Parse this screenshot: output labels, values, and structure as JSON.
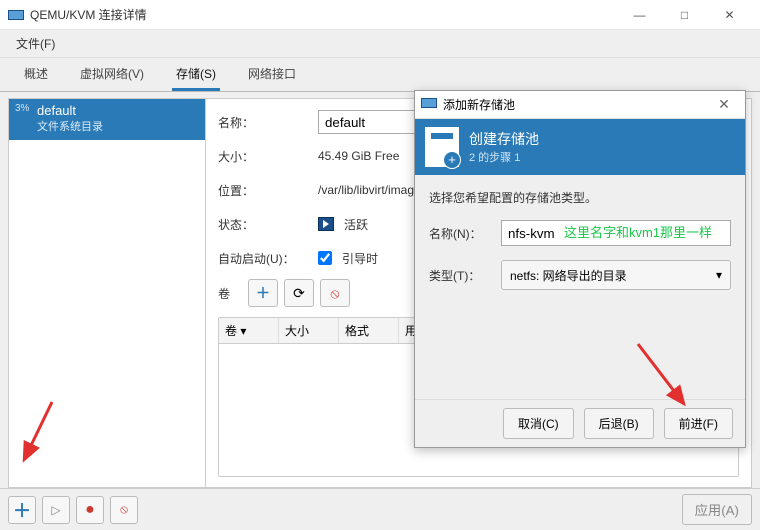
{
  "window": {
    "title": "QEMU/KVM 连接详情",
    "menu": {
      "file": "文件(F)"
    },
    "close_glyph": "✕",
    "max_glyph": "□",
    "min_glyph": "—"
  },
  "tabs": {
    "overview": "概述",
    "vnet": "虚拟网络(V)",
    "storage": "存储(S)",
    "netiface": "网络接口"
  },
  "sidebar": {
    "usage_pct": "3%",
    "pool_name": "default",
    "pool_sub": "文件系统目录"
  },
  "detail": {
    "name_label": "名称：",
    "name_value": "default",
    "size_label": "大小：",
    "size_value": "45.49 GiB Free",
    "location_label": "位置：",
    "location_value": "/var/lib/libvirt/images",
    "status_label": "状态：",
    "status_value": "活跃",
    "autostart_label": "自动启动(U)：",
    "autostart_value": "引导时",
    "volumes_label": "卷",
    "cols": {
      "name": "卷 ▾",
      "size": "大小",
      "format": "格式",
      "usedby": "用途"
    }
  },
  "bottombar": {
    "apply": "应用(A)"
  },
  "dialog": {
    "title": "添加新存储池",
    "banner_title": "创建存储池",
    "banner_step": "2 的步骤 1",
    "message": "选择您希望配置的存储池类型。",
    "name_label": "名称(N)：",
    "name_value": "nfs-kvm",
    "type_label": "类型(T)：",
    "type_value": "netfs: 网络导出的目录",
    "cancel": "取消(C)",
    "back": "后退(B)",
    "forward": "前进(F)",
    "close_glyph": "✕",
    "dropdown_glyph": "▾"
  },
  "annotation": "这里名字和kvm1那里一样",
  "icons": {
    "plus": "＋",
    "refresh": "⟳",
    "delete": "⦸",
    "play": "▷",
    "record": "●"
  }
}
